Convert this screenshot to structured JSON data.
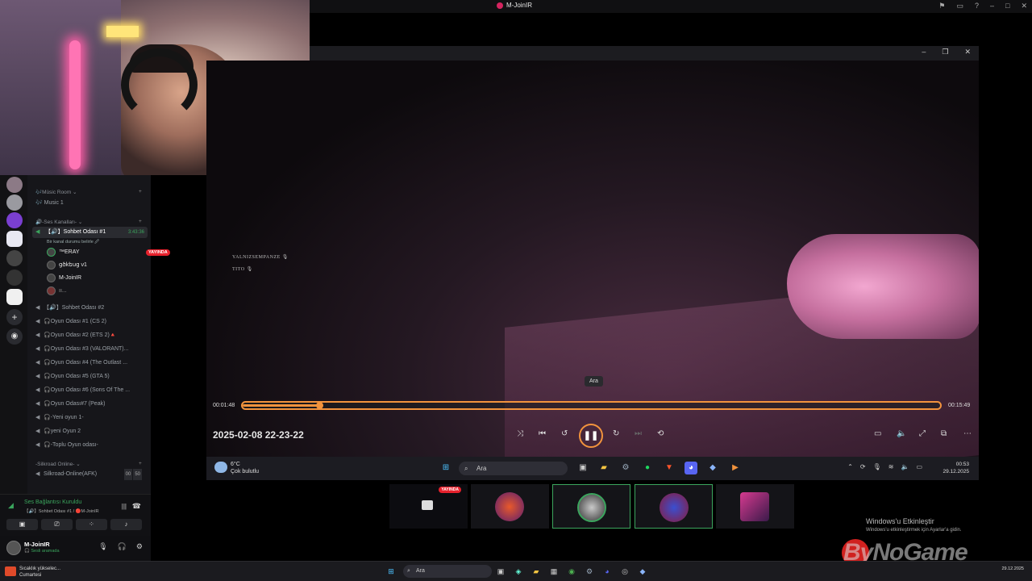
{
  "window": {
    "title": "M-JoinIR"
  },
  "sidebar": {
    "categories": [
      {
        "label": "🎶Müsic Room ⌄"
      },
      {
        "label": "🔊-Ses Kanalları- ⌄"
      },
      {
        "label": "-Silkroad Online- ⌄"
      }
    ],
    "music_channel": "🎶 Music 1",
    "active_channel": {
      "label": "【🔊】Sohbet Odası #1",
      "time": "3:43:36",
      "status": "Bir kanal durumu belirle 🖉"
    },
    "live_badge": "YAYINDA",
    "users": [
      "™ERAY",
      "ցծkեսց ν1",
      "M-JoinIR",
      "ıı..."
    ],
    "channels": [
      "【🔊】Sohbet Odası #2",
      "🎧Oyun Odası #1 (CS 2)",
      "🎧Oyun Odası #2 (ETS 2)🔺",
      "🎧Oyun Odası #3 (VALORANT)...",
      "🎧Oyun Odası #4 (The Outlast ...",
      "🎧Oyun Odası #5 (GTA 5)",
      "🎧Oyun Odası #6 (Sons Of The ...",
      "🎧Oyun Odası#7 (Peak)",
      "🎧-Yeni oyun 1-",
      "🎧yeni Oyun 2",
      "🎧-Toplu Oyun odası-"
    ],
    "silkroad_channel": {
      "label": "Silkroad-Online(AFK)",
      "limit_a": "00",
      "limit_b": "50"
    }
  },
  "voice_panel": {
    "status": "Ses Bağlantısı Kuruldu",
    "detail": "【🔊】Sohbet Odası #1 / 🔴M-JoinIR"
  },
  "user_panel": {
    "name": "M-JoinIR",
    "status": "🎧 Sesli aramada"
  },
  "video": {
    "mic_labels": [
      "YALNIZSEMPANZE",
      "TITO"
    ],
    "tooltip": "Ara",
    "elapsed": "00:01:48",
    "duration": "00:15:49",
    "progress_fraction": 0.11,
    "date_label": "2025-02-08 22-23-22"
  },
  "inner_taskbar": {
    "temperature": "6°C",
    "condition": "Çok bulutlu",
    "search_placeholder": "Ara",
    "time": "00:53",
    "date": "29.12.2025"
  },
  "thumbnails": {
    "live_badge": "YAYINDA"
  },
  "activation": {
    "title": "Windows'u Etkinleştir",
    "detail": "Windows'u etkinleştirmek için Ayarlar'a gidin."
  },
  "brand_text": "ByNoGame",
  "host_taskbar": {
    "weather_line1": "Sıcaklık yükselec...",
    "weather_line2": "Cumartesi",
    "search_placeholder": "Ara",
    "time": "",
    "date": "29.12.2025"
  },
  "colors": {
    "accent": "#f2933d",
    "live": "#e6212c",
    "online": "#3ba55d"
  }
}
